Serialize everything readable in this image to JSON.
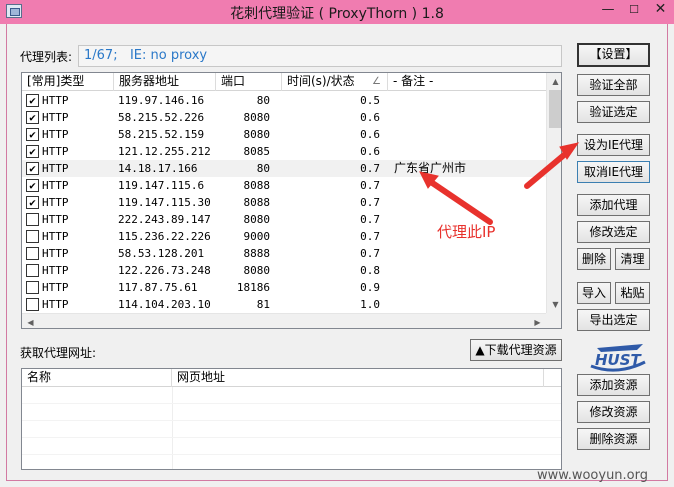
{
  "window": {
    "title": "花刺代理验证 ( ProxyThorn ) 1.8",
    "min_glyph": "—",
    "max_glyph": "☐",
    "close_glyph": "✕",
    "title_color": "#f07cb0"
  },
  "proxy_list_label": "代理列表:",
  "status_text": "1/67;   IE: no proxy",
  "proxy_table": {
    "columns": [
      "[常用]类型",
      "服务器地址",
      "端口",
      "时间(s)/状态",
      "- 备注 -"
    ],
    "sort_indicator": "∠",
    "rows": [
      {
        "checked": true,
        "type": "HTTP",
        "ip": "119.97.146.16",
        "port": "80",
        "time": "0.5",
        "note": ""
      },
      {
        "checked": true,
        "type": "HTTP",
        "ip": "58.215.52.226",
        "port": "8080",
        "time": "0.6",
        "note": ""
      },
      {
        "checked": true,
        "type": "HTTP",
        "ip": "58.215.52.159",
        "port": "8080",
        "time": "0.6",
        "note": ""
      },
      {
        "checked": true,
        "type": "HTTP",
        "ip": "121.12.255.212",
        "port": "8085",
        "time": "0.6",
        "note": ""
      },
      {
        "checked": true,
        "type": "HTTP",
        "ip": "14.18.17.166",
        "port": "80",
        "time": "0.7",
        "note": "广东省广州市"
      },
      {
        "checked": true,
        "type": "HTTP",
        "ip": "119.147.115.6",
        "port": "8088",
        "time": "0.7",
        "note": ""
      },
      {
        "checked": true,
        "type": "HTTP",
        "ip": "119.147.115.30",
        "port": "8088",
        "time": "0.7",
        "note": ""
      },
      {
        "checked": false,
        "type": "HTTP",
        "ip": "222.243.89.147",
        "port": "8080",
        "time": "0.7",
        "note": ""
      },
      {
        "checked": false,
        "type": "HTTP",
        "ip": "115.236.22.226",
        "port": "9000",
        "time": "0.7",
        "note": ""
      },
      {
        "checked": false,
        "type": "HTTP",
        "ip": "58.53.128.201",
        "port": "8888",
        "time": "0.7",
        "note": ""
      },
      {
        "checked": false,
        "type": "HTTP",
        "ip": "122.226.73.248",
        "port": "8080",
        "time": "0.8",
        "note": ""
      },
      {
        "checked": false,
        "type": "HTTP",
        "ip": "117.87.75.61",
        "port": "18186",
        "time": "0.9",
        "note": ""
      },
      {
        "checked": false,
        "type": "HTTP",
        "ip": "114.104.203.10",
        "port": "81",
        "time": "1.0",
        "note": ""
      }
    ],
    "highlighted_row": 4
  },
  "fetch_label": "获取代理网址:",
  "download_button": "▲下载代理资源",
  "resource_table": {
    "columns": [
      "名称",
      "网页地址"
    ]
  },
  "buttons": {
    "settings": "【设置】",
    "verify_all": "验证全部",
    "verify_selected": "验证选定",
    "set_ie_proxy": "设为IE代理",
    "cancel_ie_proxy": "取消IE代理",
    "add_proxy": "添加代理",
    "edit_selected": "修改选定",
    "delete": "删除",
    "clear": "清理",
    "import": "导入",
    "paste": "粘贴",
    "export_selected": "导出选定",
    "add_resource": "添加资源",
    "edit_resource": "修改资源",
    "delete_resource": "删除资源"
  },
  "logo_text": "HUST",
  "annotation": {
    "text": "代理此IP",
    "color": "#e8322d"
  },
  "watermark": "www.wooyun.org"
}
